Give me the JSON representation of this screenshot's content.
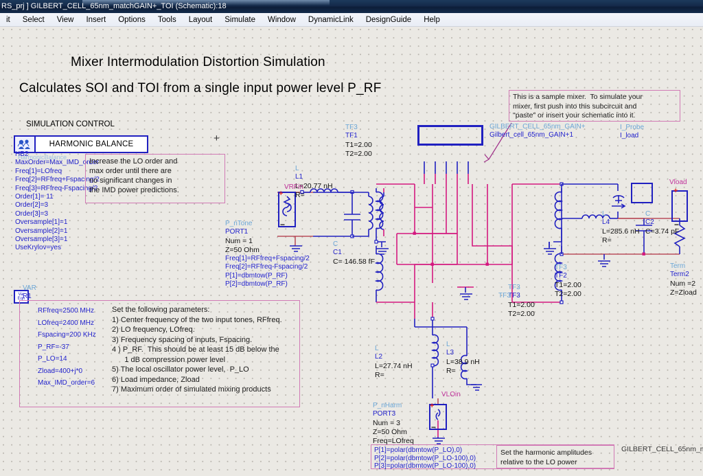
{
  "window": {
    "title": "RS_prj ] GILBERT_CELL_65nm_matchGAIN+_TOI (Schematic):18"
  },
  "menu": {
    "items": [
      "it",
      "Select",
      "View",
      "Insert",
      "Options",
      "Tools",
      "Layout",
      "Simulate",
      "Window",
      "DynamicLink",
      "DesignGuide",
      "Help"
    ]
  },
  "headings": {
    "title1": "Mixer Intermodulation Distortion Simulation",
    "title2": "Calculates SOI and  TOI from a single input power level P_RF",
    "section_label": "SIMULATION CONTROL"
  },
  "hb": {
    "controller_label": "HARMONIC BALANCE",
    "icon": "harmonic-balance-icon",
    "instance_hidden": "HarmonicBalance",
    "name": "HB2",
    "params": [
      "MaxOrder=Max_IMD_order",
      "Freq[1]=LOfreq",
      "Freq[2]=RFfreq+Fspacing/2",
      "Freq[3]=RFfreq-Fspacing/2",
      "Order[1]= 11",
      "Order[2]=3",
      "Order[3]=3",
      "Oversample[1]=1",
      "Oversample[2]=1",
      "Oversample[3]=1",
      "UseKrylov=yes"
    ]
  },
  "notes": {
    "hb_note": "Increase the LO order and\nmax order until there are\nno significant changes in\nthe IMD power predictions.",
    "mixer_note": "This is a sample mixer.  To simulate your\nmixer, first push into this subcircuit and\n\"paste\" or insert your schematic into it.",
    "harmonic_note": "Set the harmonic amplitudes\nrelative to the LO power",
    "var_note": "Set the following parameters:\n1) Center frequency of the two input tones, RFfreq.\n2) LO frequency, LOfreq.\n3) Frequency spacing of inputs, Fspacing.\n4 ) P_RF.  This should be at least 15 dB below the\n      1 dB compression power level\n5) The local oscillator power level,  P_LO\n6) Load impedance, Zload\n7) Maximum order of simulated mixing products"
  },
  "var": {
    "type": "VAR",
    "name": "R1",
    "params": [
      "RFfreq=2500 MHz",
      "LOfreq=2400 MHz",
      "Fspacing=200 KHz",
      "P_RF=-37",
      "P_LO=14",
      "Zload=400+j*0",
      "Max_IMD_order=6"
    ]
  },
  "components": {
    "port1": {
      "type": "P_nTone",
      "name": "PORT1",
      "params": [
        "Num = 1",
        "Z=50 Ohm",
        "Freq[1]=RFfreq+Fspacing/2",
        "Freq[2]=RFfreq-Fspacing/2",
        "P[1]=dbmtow(P_RF)",
        "P[2]=dbmtow(P_RF)"
      ]
    },
    "port3": {
      "type": "P_nHarm",
      "name": "PORT3",
      "params": [
        "Num = 3",
        "Z=50 Ohm",
        "Freq=LOfreq",
        "P[1]=polar(dbmtow(P_LO),0)",
        "P[2]=polar(dbmtow(P_LO-100),0)",
        "P[3]=polar(dbmtow(P_LO-100),0)"
      ]
    },
    "L1": {
      "type": "L",
      "name": "L1",
      "value": "L=20.77 nH",
      "r": "R="
    },
    "L2": {
      "type": "L",
      "name": "L2",
      "value": "L=27.74 nH",
      "r": "R="
    },
    "L3": {
      "type": "L",
      "name": "L3",
      "value": "L=38.9 nH",
      "r": "R="
    },
    "L4": {
      "type": "L",
      "name": "L4",
      "value": "L=285.6 nH",
      "r": "R="
    },
    "C1": {
      "type": "C",
      "name": "C1",
      "value": "C= 146.58 fF"
    },
    "C2": {
      "type": "C",
      "name": "C2",
      "value": "C=3.74 pF"
    },
    "TF1": {
      "type": "TF3",
      "name": "TF1",
      "t1": "T1=2.00",
      "t2": "T2=2.00"
    },
    "TF2": {
      "type": "TF3",
      "name": "TF2",
      "t1": "T1=2.00",
      "t2": "T2=2.00"
    },
    "TF3": {
      "type": "TF3",
      "name": "TF3",
      "t1": "T1=2.00",
      "t2": "T2=2.00"
    },
    "probe": {
      "type": "I_Probe",
      "name": "I_load"
    },
    "term": {
      "type": "Term",
      "name": "Term2",
      "num": "Num =2",
      "z": "Z=Zload"
    },
    "subckt": {
      "type": "GILBERT_CELL_65nm_GAIN+",
      "name": "Gilbert_cell_65nm_GAIN+1"
    }
  },
  "net_labels": {
    "vrfin": "VRFin",
    "vload": "Vload",
    "vloin": "VLOin"
  },
  "footer": {
    "watermark": "GILBERT_CELL_65nm_m"
  },
  "colors": {
    "wire_blue": "#2020c0",
    "wire_magenta": "#d4187f",
    "wire_red": "#b03040",
    "note_border": "#d17ab5",
    "label_cyan": "#6ba6d6",
    "canvas_bg": "#ebe9e4",
    "titlebar": "#14294a"
  }
}
